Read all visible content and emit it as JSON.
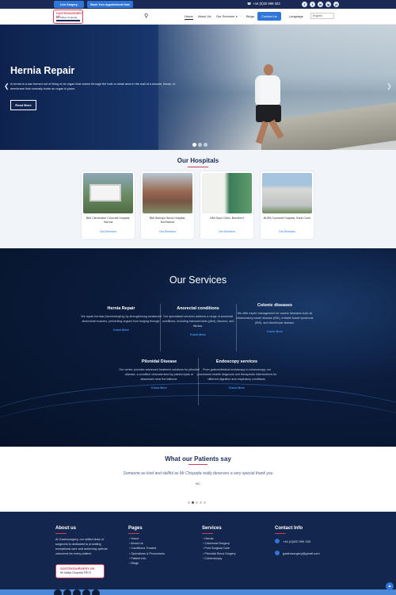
{
  "topbar": {
    "live_surgery": "Live Surgery",
    "book_appointment": "Book Your Appointment Now",
    "phone": "+44 (0)20 999 333",
    "social": [
      "f",
      "t",
      "in",
      "ig",
      "yt"
    ]
  },
  "nav": {
    "logo_line1": "GASTROSURGERY UK",
    "logo_line2": "Mr. Aditya Chopada FRCS",
    "items": [
      "Home",
      "About Us",
      "Our Services",
      "Blogs"
    ],
    "contact": "Contact Us",
    "language_label": "Language",
    "language_value": "English"
  },
  "hero": {
    "title": "Hernia Repair",
    "text": "A hernia is a sac formed out of lining of an organ that comes through the hole or weak area in the wall of a muscle, tissue, or membrane that normally holds an organ in place.",
    "button": "Read More"
  },
  "hospitals": {
    "title": "Our Hospitals",
    "cards": [
      {
        "name": "BMI Clementine Churchill Hospital, Harrow",
        "link": "Get Direction"
      },
      {
        "name": "BMI Bishops Wood Hospital, Northwood",
        "link": "Get Direction"
      },
      {
        "name": "BMI Syon Clinic, Brentford",
        "link": "Get Direction"
      },
      {
        "name": "BUPA Cromwell Hospital, Earls Court",
        "link": "Get Direction"
      }
    ]
  },
  "services": {
    "title": "Our Services",
    "items": [
      {
        "title": "Hernia Repair",
        "desc": "We repair hernias (herniorrhaphy) by strengthening weakened abdominal muscles, preventing organs from bulging through.",
        "link": "Know More"
      },
      {
        "title": "Anorectal conditions",
        "desc": "Our specialised services address a range of anorectal conditions, including haemorrhoids (piles), fissures, and fistulas.",
        "link": "Know More"
      },
      {
        "title": "Colonic diseases",
        "desc": "We offer expert management for colonic diseases such as inflammatory bowel disease (IBD), irritable bowel syndrome (IBS), and diverticular disease.",
        "link": "Know More"
      },
      {
        "title": "Pilonidal Disease",
        "desc": "Our center provides advanced treatment solutions for pilonidal disease, a condition characterized by painful cysts or abscesses near the tailbone.",
        "link": "Know More"
      },
      {
        "title": "Endoscopy services",
        "desc": "From gastrointestinal endoscopy to colonoscopy, our procedures enable diagnosis and therapeutic interventions for different digestive and respiratory conditions.",
        "link": "Know More"
      }
    ]
  },
  "testimonials": {
    "title": "What our Patients say",
    "quote": "Someone as kind and skillful as Mr Chopada really deserves a very special thank you",
    "author": "MC"
  },
  "footer": {
    "about_title": "About us",
    "about_text": "At Gastrosurgery, our skilled team of surgeons is dedicated to providing exceptional care and achieving optimal outcomes for every patient.",
    "logo_line1": "GASTROSURGERY UK",
    "logo_line2": "Mr Aditya Chopada FRCS",
    "pages_title": "Pages",
    "pages": [
      "Home",
      "About Us",
      "Conditions Treated",
      "Operations & Procedures",
      "Patient Info",
      "Blogs"
    ],
    "services_title": "Services",
    "services": [
      "Hernia",
      "Colorectal Surgery",
      "Post Surgical Care",
      "Pilonidal Sinus Surgery",
      "Colonoscopy"
    ],
    "contact_title": "Contact Info",
    "phone": "+44 (0)020 999 333",
    "email": "gastrosurgery@gmail.com"
  }
}
